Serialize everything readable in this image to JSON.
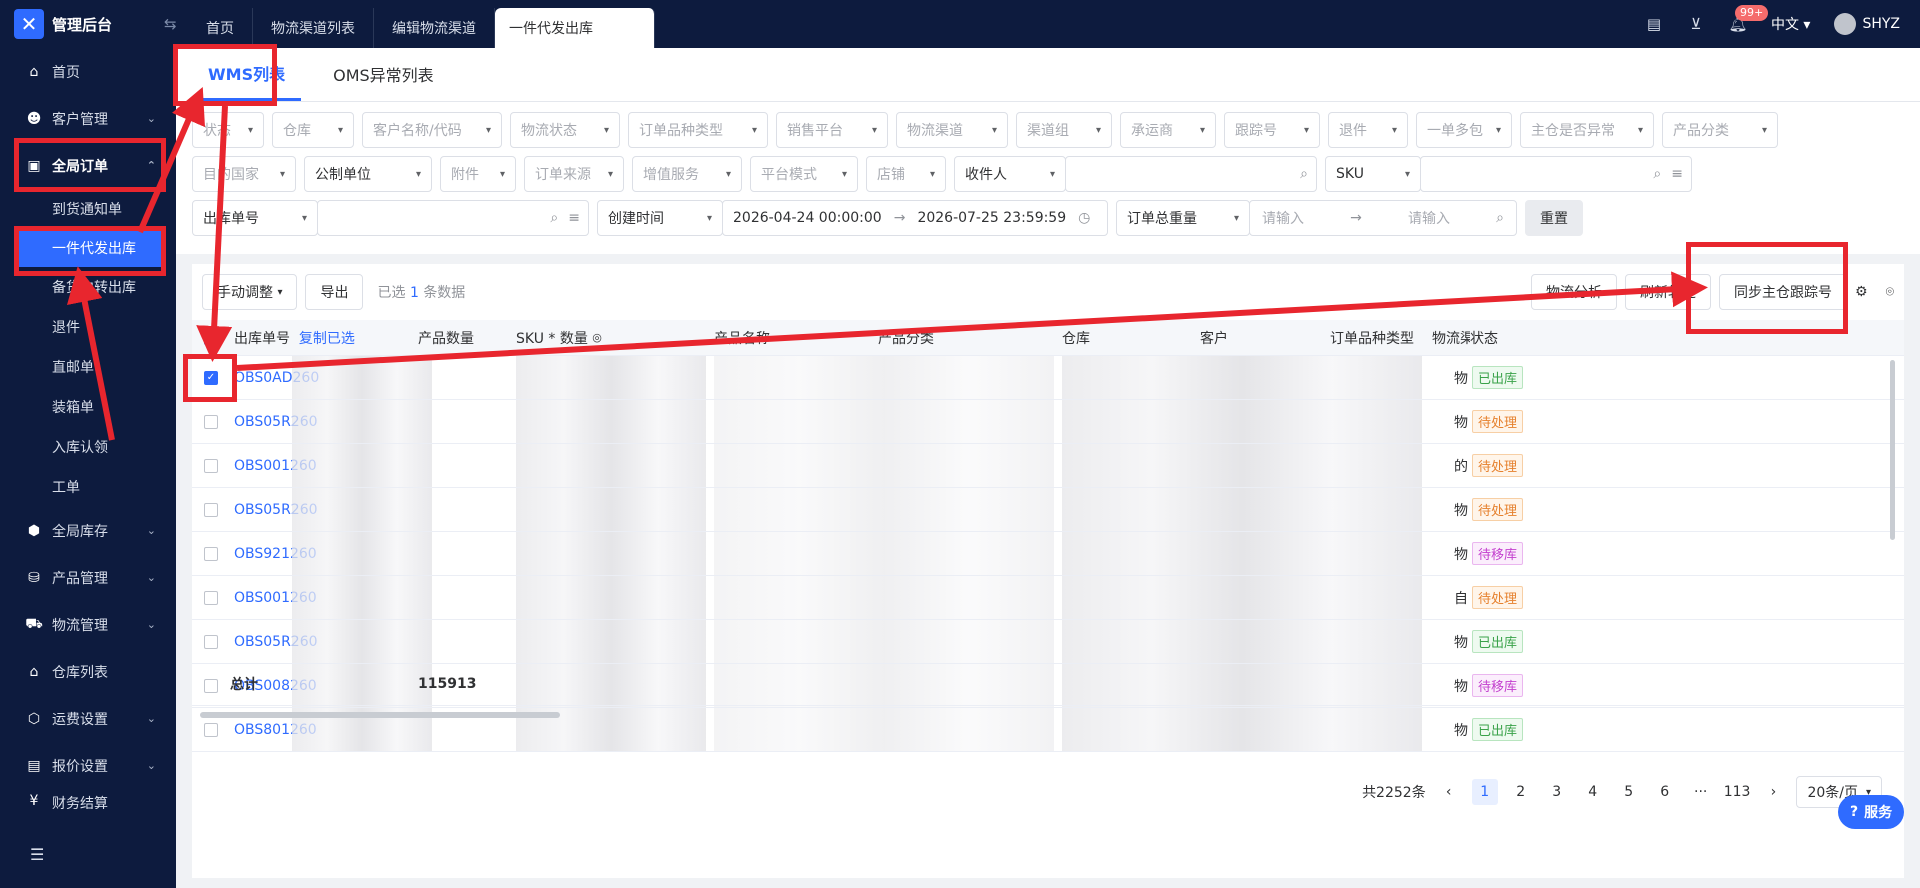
{
  "topbar": {
    "brand": "管理后台",
    "tabs": [
      "首页",
      "物流渠道列表",
      "编辑物流渠道",
      "一件代发出库"
    ],
    "badge": "99+",
    "language": "中文",
    "user": "SHYZ"
  },
  "sidebar": {
    "items": [
      {
        "label": "首页",
        "icon": "home-icon"
      },
      {
        "label": "客户管理",
        "icon": "user-icon"
      },
      {
        "label": "全局订单",
        "icon": "order-icon"
      }
    ],
    "sub_items": [
      "到货通知单",
      "一件代发出库",
      "备货中转出库",
      "退件",
      "直邮单",
      "装箱单",
      "入库认领",
      "工单"
    ],
    "items_after": [
      {
        "label": "全局库存",
        "icon": "inventory-icon"
      },
      {
        "label": "产品管理",
        "icon": "product-icon"
      },
      {
        "label": "物流管理",
        "icon": "truck-icon"
      },
      {
        "label": "仓库列表",
        "icon": "warehouse-icon"
      },
      {
        "label": "运费设置",
        "icon": "freight-icon"
      },
      {
        "label": "报价设置",
        "icon": "quote-icon"
      },
      {
        "label": "财务结算",
        "icon": "finance-icon"
      }
    ]
  },
  "subtabs": [
    "WMS列表",
    "OMS异常列表"
  ],
  "filters": {
    "row1": [
      "状态",
      "仓库",
      "客户名称/代码",
      "物流状态",
      "订单品种类型",
      "销售平台",
      "物流渠道",
      "渠道组",
      "承运商",
      "跟踪号",
      "退件",
      "一单多包",
      "主仓是否异常",
      "产品分类"
    ],
    "row2": [
      "目的国家",
      "公制单位",
      "附件",
      "订单来源",
      "增值服务",
      "平台模式",
      "店铺",
      "收件人",
      "SKU"
    ],
    "row3": {
      "order_no": "出库单号",
      "time_type": "创建时间",
      "date_start": "2026-04-24 00:00:00",
      "date_end": "2026-07-25 23:59:59",
      "weight": "订单总重量",
      "placeholder_min": "请输入",
      "placeholder_max": "请输入",
      "reset": "重置"
    }
  },
  "toolbar": {
    "manual_adjust": "手动调整",
    "export": "导出",
    "selected_prefix": "已选",
    "selected_count": "1",
    "selected_suffix": "条数据",
    "logistics_analysis": "物流分析",
    "refresh": "刷新轨迹",
    "sync_tracking": "同步主仓跟踪号"
  },
  "table": {
    "headers": {
      "order_no": "出库单号",
      "copy_selected": "复制已选",
      "qty": "产品数量",
      "sku_qty": "SKU * 数量",
      "product_name": "产品名称",
      "category": "产品分类",
      "warehouse": "仓库",
      "customer": "客户",
      "order_type": "订单品种类型",
      "logistics": "物流渠",
      "status": "状态"
    },
    "rows": [
      {
        "no": "OBS0AD260",
        "logi": "物",
        "status": "已出库",
        "kind": "done",
        "checked": true
      },
      {
        "no": "OBS05R260",
        "logi": "物",
        "status": "待处理",
        "kind": "pend",
        "checked": false
      },
      {
        "no": "OBS001260",
        "logi": "的",
        "status": "待处理",
        "kind": "pend",
        "checked": false
      },
      {
        "no": "OBS05R260",
        "logi": "物",
        "status": "待处理",
        "kind": "pend",
        "checked": false
      },
      {
        "no": "OBS921260",
        "logi": "物",
        "status": "待移库",
        "kind": "move",
        "checked": false
      },
      {
        "no": "OBS001260",
        "logi": "自",
        "status": "待处理",
        "kind": "pend",
        "checked": false
      },
      {
        "no": "OBS05R260",
        "logi": "物",
        "status": "已出库",
        "kind": "done",
        "checked": false
      },
      {
        "no": "OBS008260",
        "logi": "物",
        "status": "待移库",
        "kind": "move",
        "checked": false
      },
      {
        "no": "OBS801260",
        "logi": "物",
        "status": "已出库",
        "kind": "done",
        "checked": false
      }
    ],
    "total_label": "总计",
    "total_qty": "115913"
  },
  "pager": {
    "total": "共2252条",
    "pages": [
      "1",
      "2",
      "3",
      "4",
      "5",
      "6"
    ],
    "ellipsis": "···",
    "last": "113",
    "size": "20条/页"
  },
  "service": "服务",
  "colors": {
    "accent": "#2f6bff",
    "nav_bg": "#0d1b3e",
    "annotation": "#e8262e"
  }
}
